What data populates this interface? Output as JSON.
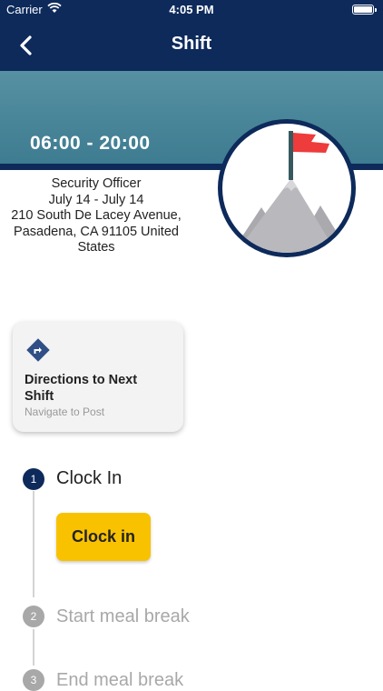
{
  "status_bar": {
    "carrier": "Carrier",
    "time": "4:05 PM"
  },
  "nav": {
    "title": "Shift",
    "back_icon": "chevron-left-icon"
  },
  "shift": {
    "time_range": "06:00 - 20:00",
    "position": "Security Officer",
    "dates": "July 14 - July 14",
    "address_line1": "210 South De Lacey Avenue,",
    "address_line2": "Pasadena, CA 91105 United",
    "address_line3": "States"
  },
  "emblem": {
    "icon": "mountain-flag-icon",
    "flag_color": "#ee3b3b",
    "mountain_color": "#b9b9bd"
  },
  "directions_card": {
    "icon": "directions-icon",
    "title": "Directions to Next Shift",
    "subtitle": "Navigate to Post"
  },
  "steps": [
    {
      "number": "1",
      "label": "Clock In",
      "active": true
    },
    {
      "number": "2",
      "label": "Start meal break",
      "active": false
    },
    {
      "number": "3",
      "label": "End meal break",
      "active": false
    }
  ],
  "clock_in_button": {
    "label": "Clock in"
  },
  "colors": {
    "navy": "#0d2a5b",
    "teal": "#4a8499",
    "accent_yellow": "#f9c200",
    "inactive_gray": "#a8a8a8"
  }
}
